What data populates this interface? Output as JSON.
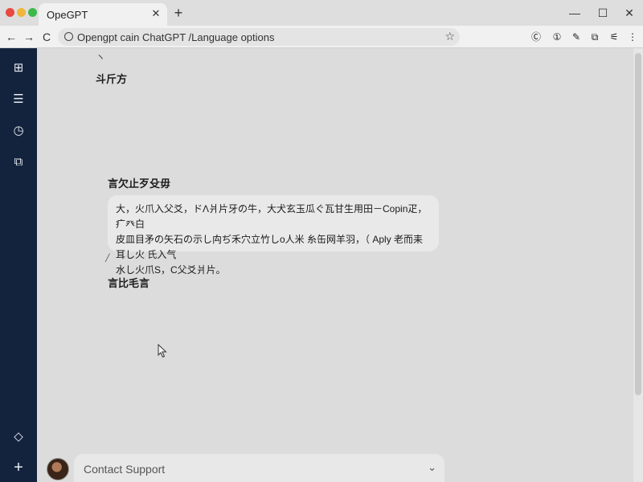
{
  "browser": {
    "tab_title": "OpeGPT",
    "tab_close": "✕",
    "new_tab": "+",
    "address": "Openɡpt cain ChatGPT /Language options",
    "window_controls": {
      "minimize": "—",
      "maximize": "☐",
      "close": "✕"
    }
  },
  "toolbar": {
    "back": "←",
    "forward": "→",
    "reload": "C",
    "bookmark": "☆"
  },
  "extensions": [
    "Ⓒ",
    "①",
    "✎",
    "⧉",
    "⚟"
  ],
  "sidebar": {
    "items": [
      {
        "icon": "chat-icon",
        "glyph": "⊞"
      },
      {
        "icon": "library-icon",
        "glyph": "☰"
      },
      {
        "icon": "history-icon",
        "glyph": "◷"
      },
      {
        "icon": "gallery-icon",
        "glyph": "⧉"
      }
    ],
    "bottom": [
      {
        "icon": "diamond-icon",
        "glyph": "◇"
      },
      {
        "icon": "plus-icon",
        "glyph": "+"
      }
    ]
  },
  "content": {
    "mark1": "ヽ",
    "heading1": "⽃⽄⽅",
    "heading2": "⾔⽋⽌⽍⽎⽏",
    "message_lines": [
      "大，⽕⽖⼊⽗⽘，ドΛ⽙⽚⽛の⽜，⼤⽝⽞⽟⽠ぐ⽡⽢⽣⽤⽥－Copin⽦，⽧⽨⽩",
      "⽪⽫⽬⽭の⽮⽯の⽰し⽱ぢ⽲⽳⽴⽵しo⼈⽶ ⽷⽸⽹⽺⽻，（ Aply ⽼⽽⽾⽿し⽕ ⽒⼊⽓",
      "⽔し⽕⽖S，C⽗⽘⽙⽚。"
    ],
    "mark2": "╱",
    "heading3": "⾔⽐⽑⾔"
  },
  "bottom_bar": {
    "support_label": "Contact Support",
    "chevron": "⌄"
  }
}
